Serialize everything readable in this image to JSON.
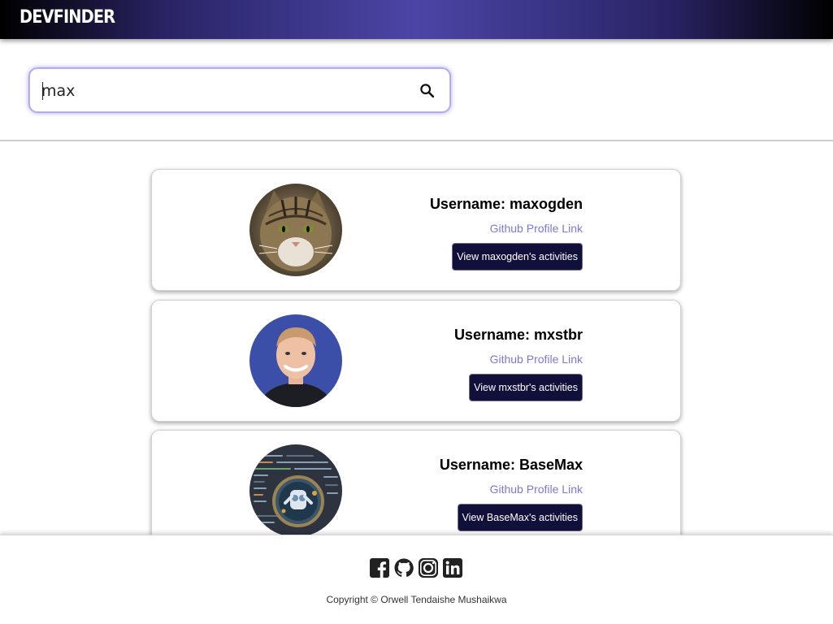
{
  "header": {
    "logo": "DEVFINDER"
  },
  "search": {
    "value": "max",
    "placeholder": ""
  },
  "results": [
    {
      "username_label": "Username: maxogden",
      "link_label": "Github Profile Link",
      "button_label": "View maxogden's activities"
    },
    {
      "username_label": "Username: mxstbr",
      "link_label": "Github Profile Link",
      "button_label": "View mxstbr's activities"
    },
    {
      "username_label": "Username: BaseMax",
      "link_label": "Github Profile Link",
      "button_label": "View BaseMax's activities"
    }
  ],
  "footer": {
    "social_icons": [
      "facebook-icon",
      "github-icon",
      "instagram-icon",
      "linkedin-icon"
    ],
    "copyright": "Copyright © Orwell Tendaishe Mushaikwa"
  },
  "colors": {
    "header_gradient_center": "#4b46a6",
    "button_bg": "#11103a",
    "link": "#7b78d8",
    "search_glow": "#a6a3f7"
  }
}
